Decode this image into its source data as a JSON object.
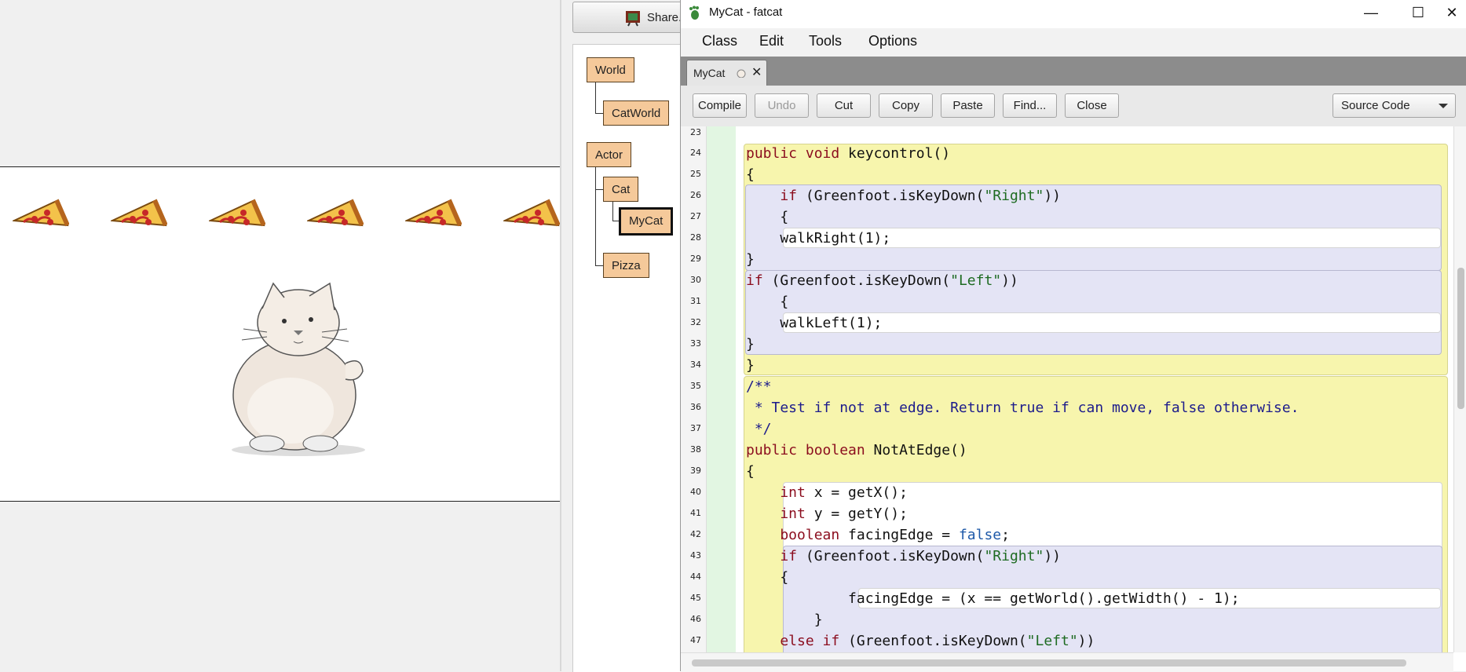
{
  "greenfoot": {
    "share_label": "Share...",
    "classes": {
      "world": "World",
      "catworld": "CatWorld",
      "actor": "Actor",
      "cat": "Cat",
      "mycat": "MyCat",
      "pizza": "Pizza"
    }
  },
  "editor": {
    "window_title": "MyCat - fatcat",
    "window_controls": {
      "minimize": "—",
      "maximize": "☐",
      "close": "✕"
    },
    "menus": [
      "Class",
      "Edit",
      "Tools",
      "Options"
    ],
    "tab": {
      "label": "MyCat",
      "close": "✕"
    },
    "toolbar": {
      "compile": "Compile",
      "undo": "Undo",
      "cut": "Cut",
      "copy": "Copy",
      "paste": "Paste",
      "find": "Find...",
      "close": "Close",
      "view_select": "Source Code"
    },
    "line_numbers": [
      "23",
      "24",
      "25",
      "26",
      "27",
      "28",
      "29",
      "30",
      "31",
      "32",
      "33",
      "34",
      "35",
      "36",
      "37",
      "38",
      "39",
      "40",
      "41",
      "42",
      "43",
      "44",
      "45",
      "46",
      "47"
    ],
    "code": {
      "l24a": "public void",
      "l24b": " keycontrol()",
      "l25": "{",
      "l26a": "    if",
      "l26b": " (Greenfoot.isKeyDown(",
      "l26c": "\"Right\"",
      "l26d": "))",
      "l27": "    {",
      "l28": "    walkRight(1);",
      "l29": "}",
      "l30a": "if",
      "l30b": " (Greenfoot.isKeyDown(",
      "l30c": "\"Left\"",
      "l30d": "))",
      "l31": "    {",
      "l32": "    walkLeft(1);",
      "l33": "}",
      "l34": "}",
      "l35": "/**",
      "l36": " * Test if not at edge. Return true if can move, false otherwise.",
      "l37": " */",
      "l38a": "public boolean",
      "l38b": " NotAtEdge()",
      "l39": "{",
      "l40a": "    int",
      "l40b": " x = getX();",
      "l41a": "    int",
      "l41b": " y = getY();",
      "l42a": "    boolean",
      "l42b": " facingEdge = ",
      "l42c": "false",
      "l42d": ";",
      "l43a": "    if",
      "l43b": " (Greenfoot.isKeyDown(",
      "l43c": "\"Right\"",
      "l43d": "))",
      "l44": "    {",
      "l45": "            facingEdge = (x == getWorld().getWidth() - 1);",
      "l46": "        }",
      "l47a": "    else if",
      "l47b": " (Greenfoot.isKeyDown(",
      "l47c": "\"Left\"",
      "l47d": "))"
    }
  }
}
